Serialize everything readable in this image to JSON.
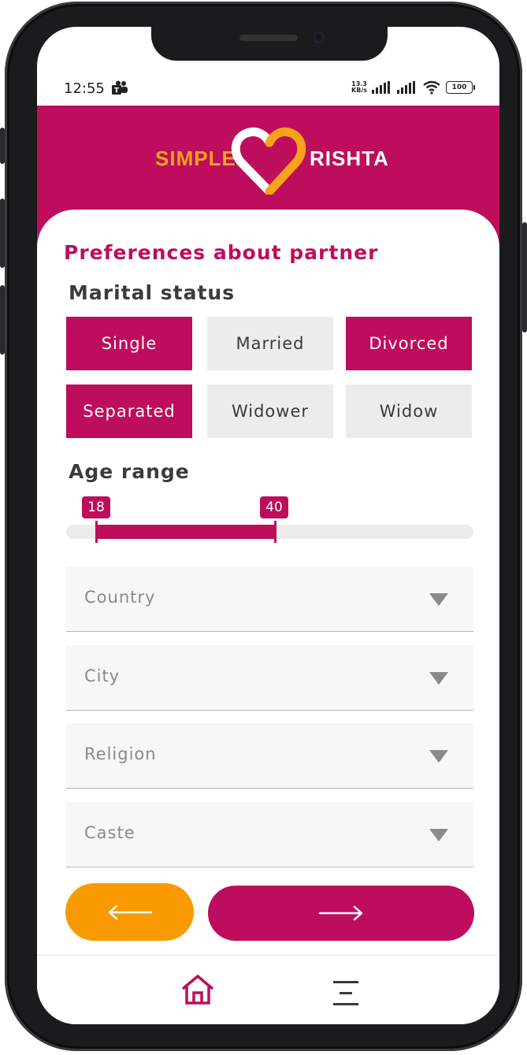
{
  "status_bar": {
    "time": "12:55",
    "net_speed_value": "13.3",
    "net_speed_unit": "KB/s",
    "battery": "100"
  },
  "header": {
    "logo_left": "SIMPLE",
    "logo_right": "RISHTA"
  },
  "page": {
    "title": "Preferences about partner"
  },
  "marital_status": {
    "heading": "Marital status",
    "options": [
      {
        "label": "Single",
        "selected": true
      },
      {
        "label": "Married",
        "selected": false
      },
      {
        "label": "Divorced",
        "selected": true
      },
      {
        "label": "Separated",
        "selected": true
      },
      {
        "label": "Widower",
        "selected": false
      },
      {
        "label": "Widow",
        "selected": false
      }
    ]
  },
  "age_range": {
    "heading": "Age range",
    "min": "18",
    "max": "40"
  },
  "dropdowns": {
    "country": "Country",
    "city": "City",
    "religion": "Religion",
    "caste": "Caste"
  },
  "buttons": {
    "back_icon": "arrow-left-icon",
    "next_icon": "arrow-right-icon"
  },
  "nav": {
    "home_icon": "home-icon",
    "menu_icon": "menu-icon"
  },
  "colors": {
    "brand": "#be0d5c",
    "accent": "#f99a00",
    "logo_orange": "#f5a31a"
  }
}
